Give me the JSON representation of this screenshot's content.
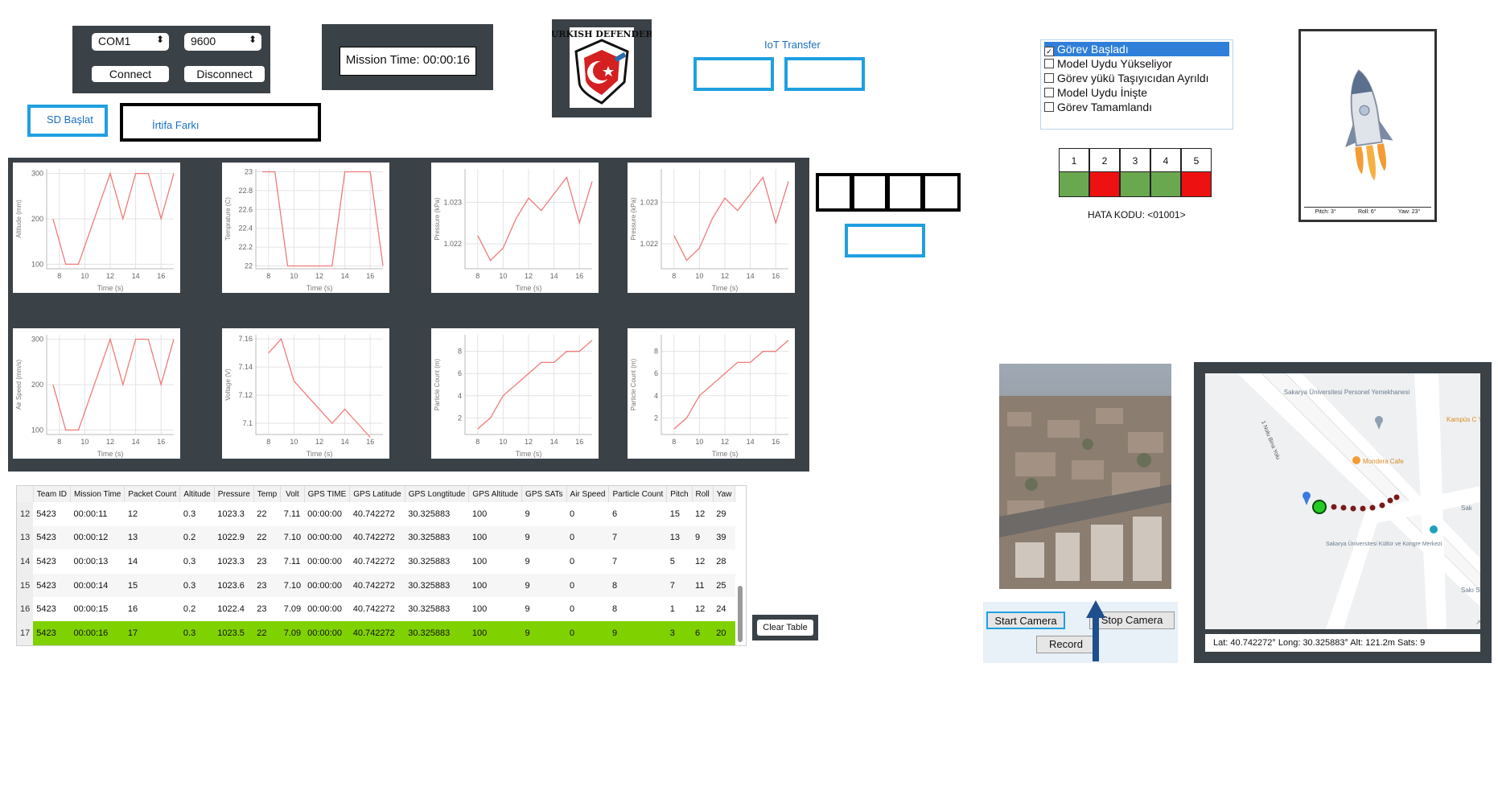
{
  "connection": {
    "port": "COM1",
    "baud": "9600",
    "connect_label": "Connect",
    "disconnect_label": "Disconnect"
  },
  "mission_time": "Mission Time: 00:00:16",
  "logo": {
    "text": "TURKISH DEFENDERS"
  },
  "iot": {
    "label": "IoT Transfer"
  },
  "sd": {
    "label": "SD Başlat"
  },
  "altitude_diff": {
    "label": "İrtifa Farkı"
  },
  "charts": [
    {
      "ylabel": "Altitude (mm)",
      "xlabel": "Time (s)",
      "xticks": [
        "8",
        "10",
        "12",
        "14",
        "16"
      ],
      "yticks": [
        "100",
        "200",
        "300"
      ]
    },
    {
      "ylabel": "Temprature (C)",
      "xlabel": "Time (s)",
      "xticks": [
        "8",
        "10",
        "12",
        "14",
        "16"
      ],
      "yticks": [
        "22",
        "22.2",
        "22.4",
        "22.6",
        "22.8",
        "23"
      ]
    },
    {
      "ylabel": "Pressure (kPa)",
      "xlabel": "Time (s)",
      "xticks": [
        "8",
        "10",
        "12",
        "14",
        "16"
      ],
      "yticks": [
        "1.022",
        "1.023"
      ]
    },
    {
      "ylabel": "Pressure (kPa)",
      "xlabel": "Time (s)",
      "xticks": [
        "8",
        "10",
        "12",
        "14",
        "16"
      ],
      "yticks": [
        "1.022",
        "1.023"
      ]
    },
    {
      "ylabel": "Air Speed (mm/s)",
      "xlabel": "Time (s)",
      "xticks": [
        "8",
        "10",
        "12",
        "14",
        "16"
      ],
      "yticks": [
        "100",
        "200",
        "300"
      ]
    },
    {
      "ylabel": "Voltage (V)",
      "xlabel": "Time (s)",
      "xticks": [
        "8",
        "10",
        "12",
        "14",
        "16"
      ],
      "yticks": [
        "7.1",
        "7.12",
        "7.14",
        "7.16"
      ]
    },
    {
      "ylabel": "Particle Count (m)",
      "xlabel": "Time (s)",
      "xticks": [
        "8",
        "10",
        "12",
        "14",
        "16"
      ],
      "yticks": [
        "2",
        "4",
        "6",
        "8"
      ]
    },
    {
      "ylabel": "Particle Count (m)",
      "xlabel": "Time (s)",
      "xticks": [
        "8",
        "10",
        "12",
        "14",
        "16"
      ],
      "yticks": [
        "2",
        "4",
        "6",
        "8"
      ]
    }
  ],
  "chart_data": [
    {
      "type": "line",
      "xlabel": "Time (s)",
      "ylabel": "Altitude (mm)",
      "xlim": [
        7,
        17
      ],
      "ylim": [
        90,
        310
      ],
      "series": [
        {
          "x": [
            7.5,
            8.5,
            9.5,
            12,
            13,
            14,
            15,
            16,
            17
          ],
          "y": [
            200,
            100,
            100,
            300,
            200,
            300,
            300,
            200,
            300
          ]
        }
      ]
    },
    {
      "type": "line",
      "xlabel": "Time (s)",
      "ylabel": "Temprature (C)",
      "xlim": [
        7,
        17
      ],
      "ylim": [
        21.97,
        23.03
      ],
      "series": [
        {
          "x": [
            7.5,
            8.5,
            9.5,
            12,
            13,
            14,
            15,
            16,
            17
          ],
          "y": [
            23,
            23,
            22,
            22,
            22,
            23,
            23,
            23,
            22
          ]
        }
      ]
    },
    {
      "type": "line",
      "xlabel": "Time (s)",
      "ylabel": "Pressure (kPa)",
      "xlim": [
        7,
        17
      ],
      "ylim": [
        1.0214,
        1.0238
      ],
      "series": [
        {
          "x": [
            8,
            9,
            10,
            11,
            12,
            13,
            14,
            15,
            16,
            17
          ],
          "y": [
            1.0222,
            1.0216,
            1.0219,
            1.0226,
            1.0231,
            1.0228,
            1.0232,
            1.0236,
            1.0225,
            1.0235
          ]
        }
      ]
    },
    {
      "type": "line",
      "xlabel": "Time (s)",
      "ylabel": "Pressure (kPa)",
      "xlim": [
        7,
        17
      ],
      "ylim": [
        1.0214,
        1.0238
      ],
      "series": [
        {
          "x": [
            8,
            9,
            10,
            11,
            12,
            13,
            14,
            15,
            16,
            17
          ],
          "y": [
            1.0222,
            1.0216,
            1.0219,
            1.0226,
            1.0231,
            1.0228,
            1.0232,
            1.0236,
            1.0225,
            1.0235
          ]
        }
      ]
    },
    {
      "type": "line",
      "xlabel": "Time (s)",
      "ylabel": "Air Speed (mm/s)",
      "xlim": [
        7,
        17
      ],
      "ylim": [
        90,
        310
      ],
      "series": [
        {
          "x": [
            7.5,
            8.5,
            9.5,
            12,
            13,
            14,
            15,
            16,
            17
          ],
          "y": [
            200,
            100,
            100,
            300,
            200,
            300,
            300,
            200,
            300
          ]
        }
      ]
    },
    {
      "type": "line",
      "xlabel": "Time (s)",
      "ylabel": "Voltage (V)",
      "xlim": [
        7,
        17
      ],
      "ylim": [
        7.092,
        7.163
      ],
      "series": [
        {
          "x": [
            8,
            9,
            10,
            11,
            12,
            13,
            14,
            15,
            16
          ],
          "y": [
            7.15,
            7.16,
            7.13,
            7.12,
            7.11,
            7.1,
            7.11,
            7.1,
            7.09
          ]
        }
      ]
    },
    {
      "type": "line",
      "xlabel": "Time (s)",
      "ylabel": "Particle Count (m)",
      "xlim": [
        7,
        17
      ],
      "ylim": [
        0.5,
        9.5
      ],
      "series": [
        {
          "x": [
            8,
            9,
            10,
            11,
            12,
            13,
            14,
            15,
            16,
            17
          ],
          "y": [
            1,
            2,
            4,
            5,
            6,
            7,
            7,
            8,
            8,
            9
          ]
        }
      ]
    },
    {
      "type": "line",
      "xlabel": "Time (s)",
      "ylabel": "Particle Count (m)",
      "xlim": [
        7,
        17
      ],
      "ylim": [
        0.5,
        9.5
      ],
      "series": [
        {
          "x": [
            8,
            9,
            10,
            11,
            12,
            13,
            14,
            15,
            16,
            17
          ],
          "y": [
            1,
            2,
            4,
            5,
            6,
            7,
            7,
            8,
            8,
            9
          ]
        }
      ]
    }
  ],
  "table": {
    "headers": [
      "Team ID",
      "Mission Time",
      "Packet Count",
      "Altitude",
      "Pressure",
      "Temp",
      "Volt",
      "GPS TIME",
      "GPS Latitude",
      "GPS Longtitude",
      "GPS Altitude",
      "GPS SATs",
      "Air Speed",
      "Particle Count",
      "Pitch",
      "Roll",
      "Yaw"
    ],
    "rows": [
      {
        "idx": "12",
        "cells": [
          "5423",
          "00:00:11",
          "12",
          "0.3",
          "1023.3",
          "22",
          "7.11",
          "00:00:00",
          "40.742272",
          "30.325883",
          "100",
          "9",
          "0",
          "6",
          "15",
          "12",
          "29"
        ]
      },
      {
        "idx": "13",
        "cells": [
          "5423",
          "00:00:12",
          "13",
          "0.2",
          "1022.9",
          "22",
          "7.10",
          "00:00:00",
          "40.742272",
          "30.325883",
          "100",
          "9",
          "0",
          "7",
          "13",
          "9",
          "39"
        ]
      },
      {
        "idx": "14",
        "cells": [
          "5423",
          "00:00:13",
          "14",
          "0.3",
          "1023.3",
          "23",
          "7.11",
          "00:00:00",
          "40.742272",
          "30.325883",
          "100",
          "9",
          "0",
          "7",
          "5",
          "12",
          "28"
        ]
      },
      {
        "idx": "15",
        "cells": [
          "5423",
          "00:00:14",
          "15",
          "0.3",
          "1023.6",
          "23",
          "7.10",
          "00:00:00",
          "40.742272",
          "30.325883",
          "100",
          "9",
          "0",
          "8",
          "7",
          "11",
          "25"
        ]
      },
      {
        "idx": "16",
        "cells": [
          "5423",
          "00:00:15",
          "16",
          "0.2",
          "1022.4",
          "23",
          "7.09",
          "00:00:00",
          "40.742272",
          "30.325883",
          "100",
          "9",
          "0",
          "8",
          "1",
          "12",
          "24"
        ]
      },
      {
        "idx": "17",
        "cells": [
          "5423",
          "00:00:16",
          "17",
          "0.3",
          "1023.5",
          "22",
          "7.09",
          "00:00:00",
          "40.742272",
          "30.325883",
          "100",
          "9",
          "0",
          "9",
          "3",
          "6",
          "20"
        ]
      }
    ],
    "highlight_row": 5,
    "highlight_color": "#7fd100",
    "clear_label": "Clear Table"
  },
  "status": {
    "items": [
      {
        "label": "Görev Başladı",
        "checked": true
      },
      {
        "label": "Model Uydu Yükseliyor",
        "checked": false
      },
      {
        "label": "Görev yükü Taşıyıcıdan Ayrıldı",
        "checked": false
      },
      {
        "label": "Model Uydu İnişte",
        "checked": false
      },
      {
        "label": "Görev Tamamlandı",
        "checked": false
      }
    ]
  },
  "error_code": {
    "numbers": [
      "1",
      "2",
      "3",
      "4",
      "5"
    ],
    "states": [
      "ok",
      "err",
      "ok",
      "ok",
      "err"
    ],
    "colors": {
      "ok": "#6aa84f",
      "err": "#ee1111"
    },
    "label": "HATA KODU: <01001>"
  },
  "rocket": {
    "pitch": "Pitch: 3°",
    "roll": "Roll: 6°",
    "yaw": "Yaw: 23°"
  },
  "camera": {
    "start": "Start Camera",
    "stop": "Stop Camera",
    "record": "Record"
  },
  "map": {
    "labels": [
      "Sakarya Üniversitesi Personel Yemekhanesi",
      "Kampüs C Yemek",
      "Mondera Cafe",
      "Sakarya Üniversitesi Kültür ve Kongre Merkezi",
      "Sak",
      "Sakı Silm",
      "1 Nolu Bina Yolu"
    ],
    "footer": "Lat: 40.742272°  Long: 30.325883°  Alt: 121.2m  Sats: 9"
  }
}
